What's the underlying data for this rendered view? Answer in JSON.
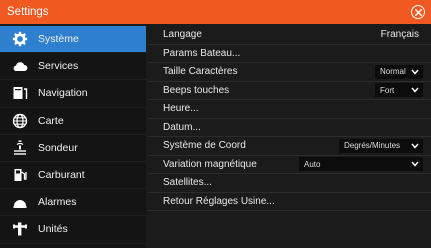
{
  "window": {
    "title": "Settings",
    "accent_color": "#f05a22",
    "selection_color": "#2f7fcf",
    "close_icon": "close-circle-icon"
  },
  "sidebar": {
    "items": [
      {
        "label": "Système",
        "icon": "gear-icon",
        "active": true
      },
      {
        "label": "Services",
        "icon": "cloud-icon",
        "active": false
      },
      {
        "label": "Navigation",
        "icon": "navigation-icon",
        "active": false
      },
      {
        "label": "Carte",
        "icon": "globe-icon",
        "active": false
      },
      {
        "label": "Sondeur",
        "icon": "sonar-icon",
        "active": false
      },
      {
        "label": "Carburant",
        "icon": "fuel-pump-icon",
        "active": false
      },
      {
        "label": "Alarmes",
        "icon": "alarm-icon",
        "active": false
      },
      {
        "label": "Unités",
        "icon": "units-icon",
        "active": false
      }
    ]
  },
  "settings": {
    "langage": {
      "label": "Langage",
      "value": "Français"
    },
    "params_bateau": {
      "label": "Params Bateau..."
    },
    "taille_caracteres": {
      "label": "Taille Caractères",
      "value": "Normal"
    },
    "beeps_touches": {
      "label": "Beeps touches",
      "value": "Fort"
    },
    "heure": {
      "label": "Heure..."
    },
    "datum": {
      "label": "Datum..."
    },
    "systeme_coord": {
      "label": "Système de Coord",
      "value": "Degrés/Minutes"
    },
    "variation_magnetique": {
      "label": "Variation magnétique",
      "value": "Auto"
    },
    "satellites": {
      "label": "Satellites..."
    },
    "retour_reglages": {
      "label": "Retour Réglages Usine..."
    }
  }
}
